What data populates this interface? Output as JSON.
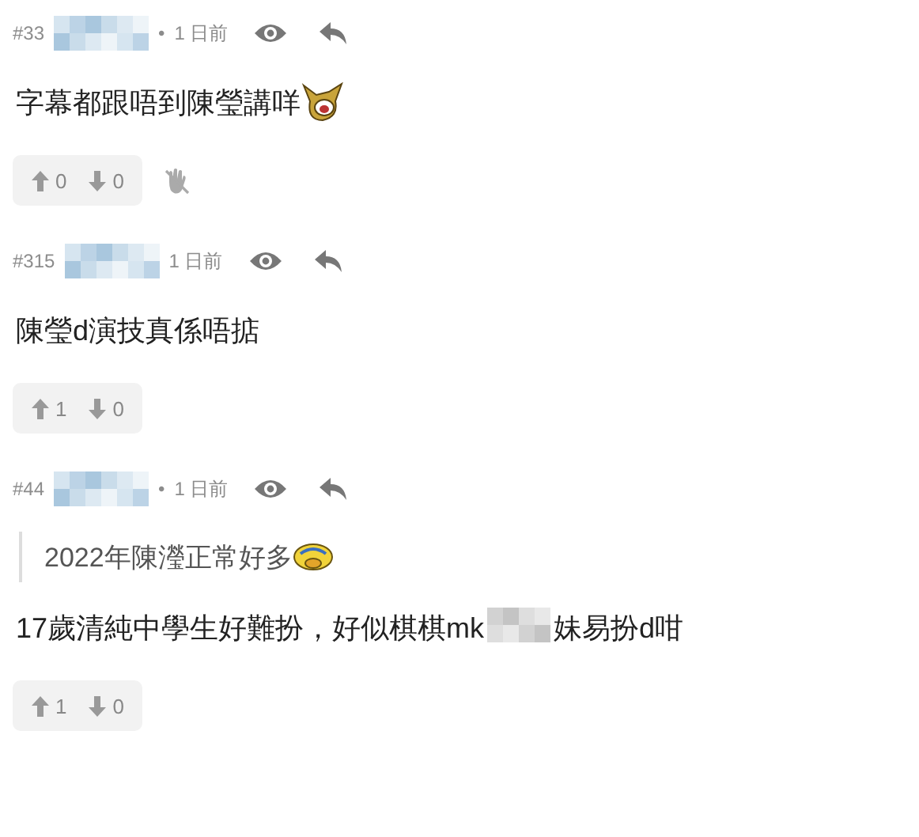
{
  "posts": [
    {
      "number": "#33",
      "separator": "•",
      "time": "1 日前",
      "body": {
        "segments": [
          "字幕都跟唔到陳瑩講咩"
        ],
        "sticker": true
      },
      "votes": {
        "up": "0",
        "down": "0"
      },
      "hidden_hand": true
    },
    {
      "number": "#315",
      "time": "1 日前",
      "body": {
        "segments": [
          "陳瑩d演技真係唔掂"
        ],
        "sticker": false
      },
      "votes": {
        "up": "1",
        "down": "0"
      },
      "hidden_hand": false
    },
    {
      "number": "#44",
      "separator": "•",
      "time": "1 日前",
      "quote": {
        "text": "2022年陳瀅正常好多",
        "sticker": true
      },
      "body": {
        "segments": [
          "17歲清純中學生好難扮，好似棋棋mk",
          "妹易扮d咁"
        ],
        "sticker": false
      },
      "votes": {
        "up": "1",
        "down": "0"
      },
      "hidden_hand": false
    }
  ]
}
